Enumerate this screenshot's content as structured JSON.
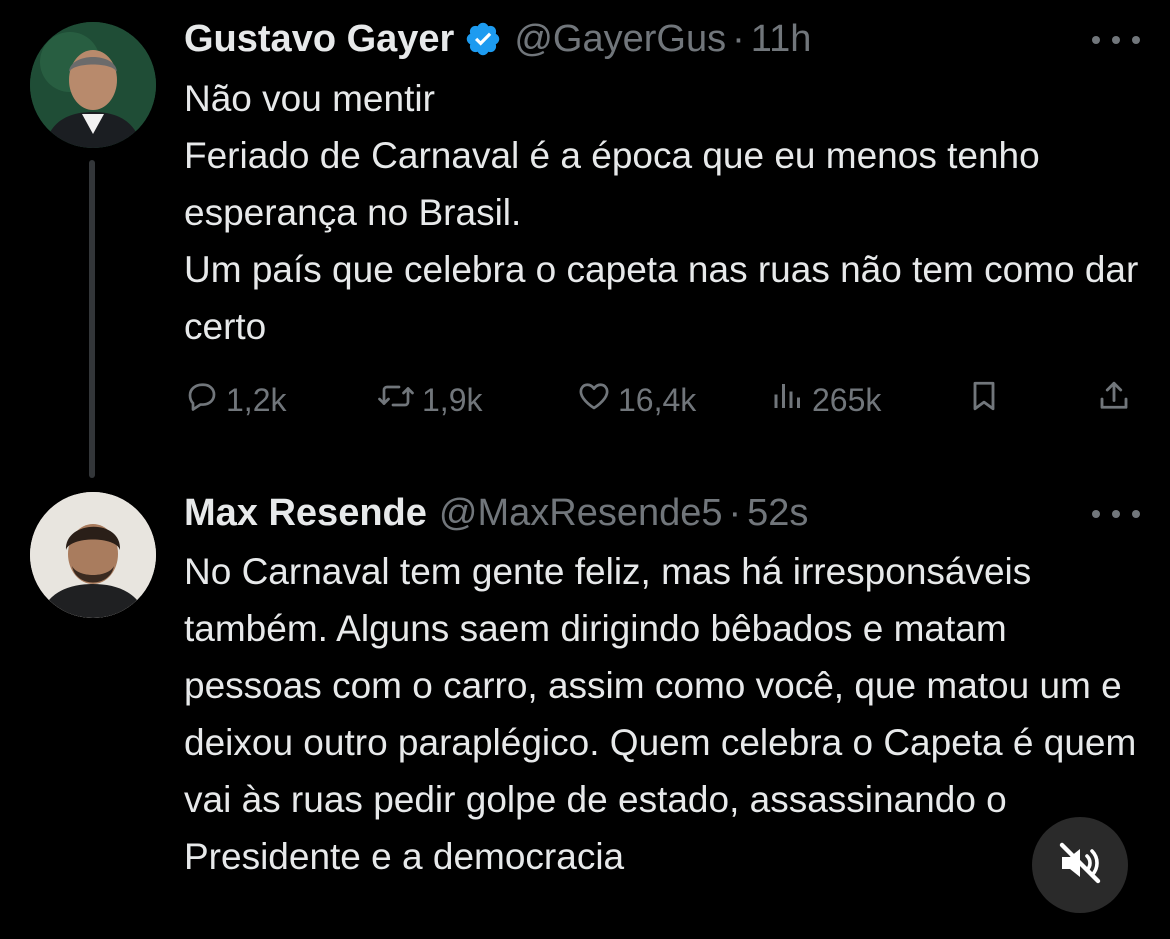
{
  "tweets": [
    {
      "author": {
        "name": "Gustavo Gayer",
        "handle": "@GayerGus",
        "verified": true
      },
      "time": "11h",
      "text": "Não vou mentir\nFeriado de Carnaval é a época que eu menos tenho esperança no Brasil.\nUm país que celebra o capeta nas ruas não tem como dar certo",
      "stats": {
        "replies": "1,2k",
        "retweets": "1,9k",
        "likes": "16,4k",
        "views": "265k"
      }
    },
    {
      "author": {
        "name": "Max Resende",
        "handle": "@MaxResende5",
        "verified": false
      },
      "time": "52s",
      "text": "No Carnaval tem gente feliz, mas há irresponsáveis também. Alguns saem dirigindo bêbados e matam pessoas com o carro, assim como você, que matou um e deixou outro paraplégico. Quem celebra o Capeta é quem vai às ruas pedir golpe de estado, assassinando o Presidente e a democracia"
    }
  ],
  "separator": "·",
  "icons": {
    "verified": "verified-badge-icon",
    "more": "more-horizontal-icon",
    "reply": "reply-icon",
    "retweet": "retweet-icon",
    "like": "heart-icon",
    "views": "views-icon",
    "bookmark": "bookmark-icon",
    "share": "share-icon",
    "mute": "muted-speaker-icon"
  },
  "colors": {
    "background": "#000000",
    "text": "#e7e9ea",
    "muted": "#71767b",
    "verified": "#1d9bf0",
    "thread_line": "#333639"
  }
}
